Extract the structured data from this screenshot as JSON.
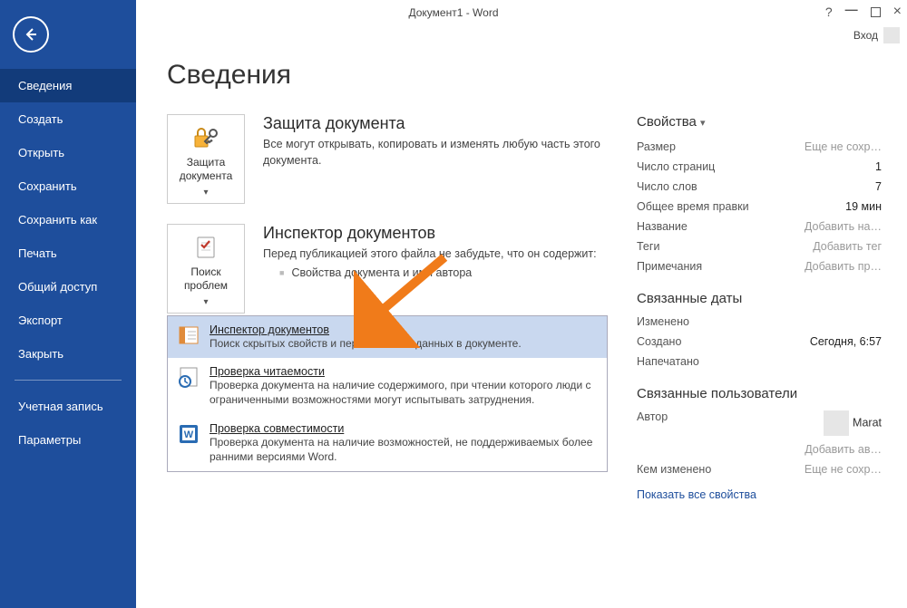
{
  "titlebar": {
    "title": "Документ1 - Word",
    "login": "Вход"
  },
  "sidebar": {
    "items": [
      "Сведения",
      "Создать",
      "Открыть",
      "Сохранить",
      "Сохранить как",
      "Печать",
      "Общий доступ",
      "Экспорт",
      "Закрыть",
      "Учетная запись",
      "Параметры"
    ],
    "active_index": 0,
    "separator_before": 9
  },
  "page": {
    "title": "Сведения"
  },
  "protect": {
    "tile_label": "Защита документа",
    "title": "Защита документа",
    "desc": "Все могут открывать, копировать и изменять любую часть этого документа."
  },
  "inspect": {
    "tile_label": "Поиск проблем",
    "title": "Инспектор документов",
    "desc": "Перед публикацией этого файла не забудьте, что он содержит:",
    "bullet": "Свойства документа и имя автора",
    "menu": [
      {
        "title": "Инспектор документов",
        "desc": "Поиск скрытых свойств и персональных данных в документе."
      },
      {
        "title": "Проверка читаемости",
        "desc": "Проверка документа на наличие содержимого, при чтении которого люди с ограниченными возможностями могут испытывать затруднения."
      },
      {
        "title": "Проверка совместимости",
        "desc": "Проверка документа на наличие возможностей, не поддерживаемых более ранними версиями Word."
      }
    ]
  },
  "props": {
    "heading": "Свойства",
    "rows": [
      {
        "label": "Размер",
        "value": "Еще не сохр…",
        "muted": true
      },
      {
        "label": "Число страниц",
        "value": "1"
      },
      {
        "label": "Число слов",
        "value": "7"
      },
      {
        "label": "Общее время правки",
        "value": "19 мин"
      },
      {
        "label": "Название",
        "value": "Добавить на…",
        "muted": true
      },
      {
        "label": "Теги",
        "value": "Добавить тег",
        "muted": true
      },
      {
        "label": "Примечания",
        "value": "Добавить пр…",
        "muted": true
      }
    ],
    "dates_heading": "Связанные даты",
    "dates": [
      {
        "label": "Изменено",
        "value": ""
      },
      {
        "label": "Создано",
        "value": "Сегодня, 6:57"
      },
      {
        "label": "Напечатано",
        "value": ""
      }
    ],
    "users_heading": "Связанные пользователи",
    "author_label": "Автор",
    "author_name": "Marat",
    "add_author": "Добавить ав…",
    "modified_by_label": "Кем изменено",
    "modified_by_value": "Еще не сохр…",
    "show_all": "Показать все свойства"
  }
}
